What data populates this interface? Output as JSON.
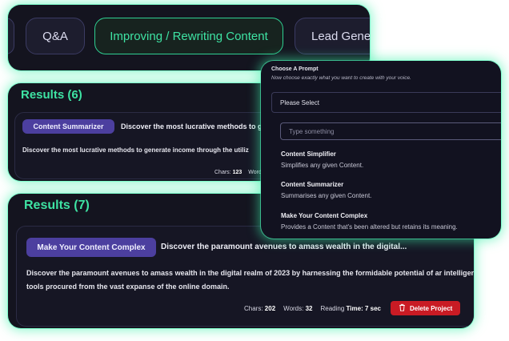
{
  "tabs": [
    {
      "label": ""
    },
    {
      "label": "Q&A"
    },
    {
      "label": "Improving / Rewriting Content"
    },
    {
      "label": "Lead Gener"
    }
  ],
  "results_6": {
    "title": "Results (6)",
    "badge": "Content Summarizer",
    "headline": "Discover the most lucrative methods to genera",
    "body": "Discover the most lucrative methods to generate income through the utiliz",
    "stats": {
      "chars_label": "Chars:",
      "chars_value": "123",
      "words_label": "Word"
    }
  },
  "results_7": {
    "title": "Results (7)",
    "badge": "Make Your Content Complex",
    "headline": "Discover the paramount avenues to amass wealth in the digital...",
    "body": "Discover the paramount avenues to amass wealth in the digital realm of 2023 by harnessing the formidable potential of ar intelligence (AI) tools procured from the vast expanse of the online domain.",
    "stats": {
      "chars_label": "Chars:",
      "chars_value": "202",
      "words_label": "Words:",
      "words_value": "32",
      "reading_label": "Reading",
      "reading_value": "Time: 7 sec"
    },
    "delete_label": "Delete Project"
  },
  "prompt": {
    "label": "Choose A Prompt",
    "sub": "Now choose exactly what you want to create with your voice.",
    "select_value": "Please Select",
    "search_placeholder": "Type something",
    "options": [
      {
        "title": "Content Simplifier",
        "desc": "Simplifies any given Content."
      },
      {
        "title": "Content Summarizer",
        "desc": "Summarises any given Content."
      },
      {
        "title": "Make Your Content Complex",
        "desc": "Provides a Content that's been altered but retains its meaning."
      }
    ]
  },
  "colors": {
    "accent": "#3ee3a3",
    "badge": "#4c3f9f",
    "danger": "#c91b24",
    "panel": "#14141f"
  },
  "icons": {
    "delete": "trash-icon"
  }
}
